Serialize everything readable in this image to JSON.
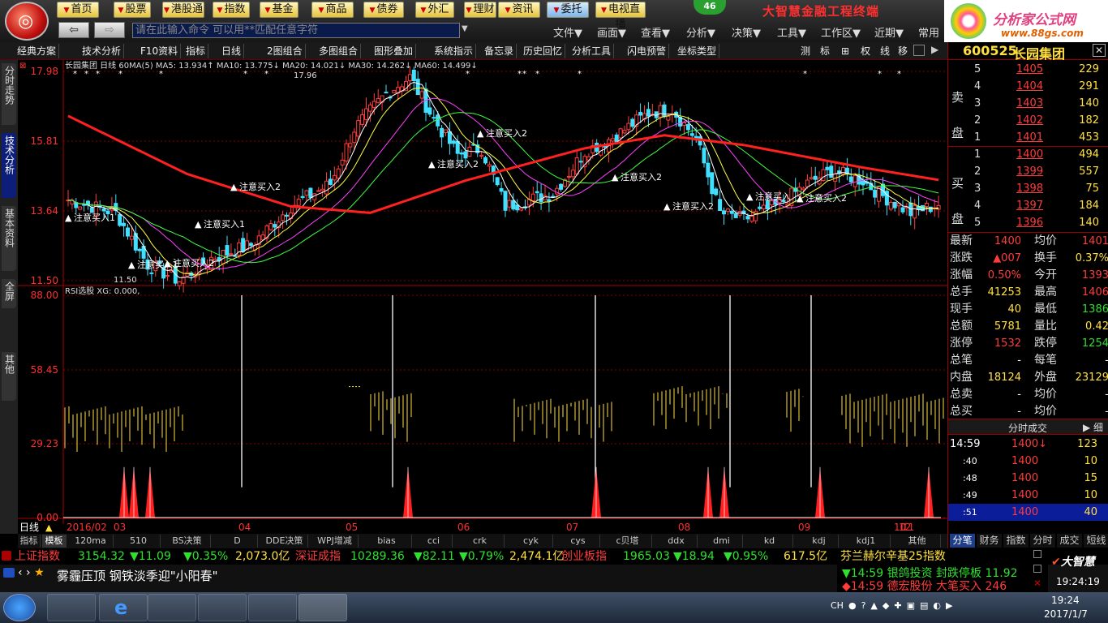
{
  "top_nav": [
    {
      "label": "首页"
    },
    {
      "label": "股票"
    },
    {
      "label": "港股通"
    },
    {
      "label": "指数"
    },
    {
      "label": "基金"
    },
    {
      "label": "商品"
    },
    {
      "label": "债券"
    },
    {
      "label": "外汇"
    },
    {
      "label": "理财"
    },
    {
      "label": "资讯"
    },
    {
      "label": "委托"
    },
    {
      "label": "电视直播"
    }
  ],
  "notify_count": "46",
  "brand_title": "大智慧金融工程终端",
  "promo": {
    "line1": "分析家公式网",
    "line2": "www.88gs.com"
  },
  "command": {
    "placeholder": "请在此输入命令   可以用**匹配任意字符"
  },
  "top_menus": [
    "文件▼",
    "画面▼",
    "查看▼",
    "分析▼",
    "决策▼",
    "工具▼",
    "工作区▼",
    "近期▼",
    "常用"
  ],
  "toolbar2": [
    "经典方案",
    "技术分析",
    "F10资料",
    "指标",
    "日线",
    "2图组合",
    "多图组合",
    "图形叠加",
    "系统指示",
    "备忘录",
    "历史回忆",
    "分析工具",
    "闪电预警",
    "坐标类型"
  ],
  "toolbar2_right": [
    "测",
    "标",
    "⊞",
    "权",
    "线",
    "移"
  ],
  "left_tabs": [
    "分时走势",
    "技术分析",
    "基本资料",
    "全屏",
    "其他"
  ],
  "main_chart": {
    "header": "长园集团 日线  60MA(5)  MA5: 13.934↑  MA10: 13.775↓  MA20: 14.021↓  MA30: 14.262↓  MA60: 14.499↓",
    "ylabels": [
      "17.98",
      "15.81",
      "13.64",
      "11.50"
    ],
    "hi_label": "17.96",
    "lo_label": "11.50",
    "annotations": [
      "注意买入1",
      "注意买入1",
      "注意买入2",
      "注意买入1",
      "注意买入2",
      "注意买入2",
      "注意买入2",
      "注意买入2",
      "注意买入",
      "注意买入2",
      "注意买入2"
    ]
  },
  "sub_chart": {
    "header": "RSI选股 XG: 0.000,",
    "ylabels": [
      "88.00",
      "58.45",
      "29.23",
      "0.00"
    ]
  },
  "xlabels": [
    "2016/02",
    "03",
    "04",
    "05",
    "06",
    "07",
    "08",
    "09",
    "10",
    "11",
    "12"
  ],
  "period_label": "日线",
  "bottom_tabs": [
    "指标",
    "模板",
    "120ma",
    "510",
    "BS决策",
    "D",
    "DDE决策",
    "WPJ增减",
    "bias",
    "cci",
    "crk",
    "cyk",
    "cys",
    "c贝塔",
    "ddx",
    "dmi",
    "kd",
    "kdj",
    "kdj1",
    "其他"
  ],
  "stock": {
    "code": "600525",
    "name": "长园集团"
  },
  "orderbook": {
    "sell": [
      {
        "lvl": "5",
        "price": "1405",
        "vol": "229"
      },
      {
        "lvl": "4",
        "price": "1404",
        "vol": "291"
      },
      {
        "lvl": "3",
        "price": "1403",
        "vol": "140"
      },
      {
        "lvl": "2",
        "price": "1402",
        "vol": "182"
      },
      {
        "lvl": "1",
        "price": "1401",
        "vol": "453"
      }
    ],
    "buy": [
      {
        "lvl": "1",
        "price": "1400",
        "vol": "494"
      },
      {
        "lvl": "2",
        "price": "1399",
        "vol": "557"
      },
      {
        "lvl": "3",
        "price": "1398",
        "vol": "75"
      },
      {
        "lvl": "4",
        "price": "1397",
        "vol": "184"
      },
      {
        "lvl": "5",
        "price": "1396",
        "vol": "140"
      }
    ],
    "sell_label": "卖 盘",
    "buy_label": "买 盘"
  },
  "quote": [
    {
      "k1": "最新",
      "v1": "1400",
      "k2": "均价",
      "v2": "1401"
    },
    {
      "k1": "涨跌",
      "v1": "▲007",
      "k2": "换手",
      "v2": "0.37%"
    },
    {
      "k1": "涨幅",
      "v1": "0.50%",
      "k2": "今开",
      "v2": "1393"
    },
    {
      "k1": "总手",
      "v1": "41253",
      "k2": "最高",
      "v2": "1406"
    },
    {
      "k1": "现手",
      "v1": "40",
      "k2": "最低",
      "v2": "1386"
    },
    {
      "k1": "总额",
      "v1": "5781",
      "k2": "量比",
      "v2": "0.42"
    },
    {
      "k1": "涨停",
      "v1": "1532",
      "k2": "跌停",
      "v2": "1254"
    },
    {
      "k1": "总笔",
      "v1": "-",
      "k2": "每笔",
      "v2": "-"
    },
    {
      "k1": "内盘",
      "v1": "18124",
      "k2": "外盘",
      "v2": "23129"
    },
    {
      "k1": "总卖",
      "v1": "-",
      "k2": "均价",
      "v2": "-"
    },
    {
      "k1": "总买",
      "v1": "-",
      "k2": "均价",
      "v2": "-"
    }
  ],
  "ticks_title": "分时成交",
  "ticks": [
    {
      "t": "14:59",
      "p": "1400↓",
      "v": "123"
    },
    {
      "t": ":40",
      "p": "1400",
      "v": "10"
    },
    {
      "t": ":48",
      "p": "1400",
      "v": "15"
    },
    {
      "t": ":49",
      "p": "1400",
      "v": "10"
    },
    {
      "t": ":51",
      "p": "1400",
      "v": "40"
    }
  ],
  "right_tabs": [
    "分笔",
    "财务",
    "指数",
    "分时",
    "成交",
    "短线"
  ],
  "index_bar": [
    {
      "text": "上证指数",
      "c": "red"
    },
    {
      "text": "3154.32",
      "c": "grn"
    },
    {
      "text": "▼11.09",
      "c": "grn"
    },
    {
      "text": "▼0.35%",
      "c": "grn"
    },
    {
      "text": "2,073.0亿",
      "c": "yel"
    },
    {
      "text": "深证成指",
      "c": "red"
    },
    {
      "text": "10289.36",
      "c": "grn"
    },
    {
      "text": "▼82.11",
      "c": "grn"
    },
    {
      "text": "▼0.79%",
      "c": "grn"
    },
    {
      "text": "2,474.1亿",
      "c": "yel"
    },
    {
      "text": "创业板指",
      "c": "red"
    },
    {
      "text": "1965.03",
      "c": "grn"
    },
    {
      "text": "▼18.94",
      "c": "grn"
    },
    {
      "text": "▼0.95%",
      "c": "grn"
    },
    {
      "text": "617.5亿",
      "c": "yel"
    },
    {
      "text": "芬兰赫尔辛基25指数",
      "c": "yel"
    }
  ],
  "news": "雾霾压顶 钢铁淡季迎\"小阳春\"",
  "alerts": [
    {
      "text": "▼14:59 银鸽投资 封跌停板 11.92",
      "c": "grn"
    },
    {
      "text": "◆14:59 德宏股份 大笔买入 246",
      "c": "red"
    }
  ],
  "dzh_logo": "大智慧",
  "clock": {
    "time": "19:24:19",
    "date": "2017/1/7",
    "tray_time": "19:24"
  },
  "tray_lang": "CH"
}
